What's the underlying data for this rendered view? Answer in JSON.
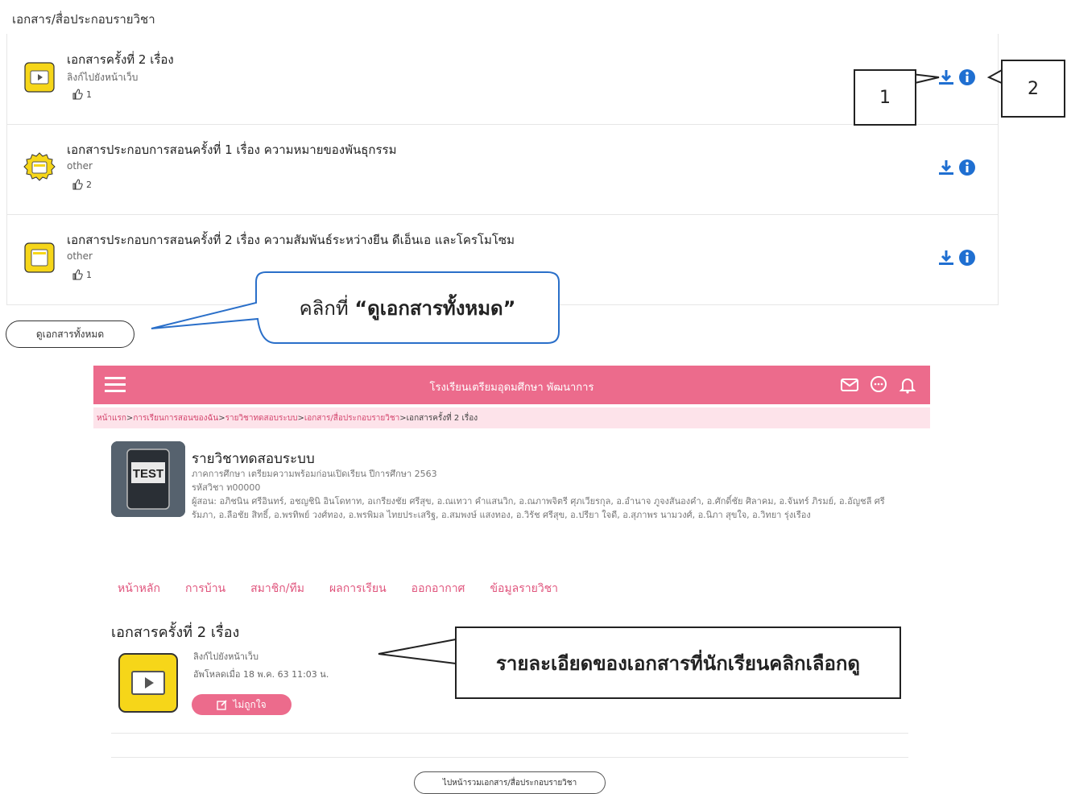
{
  "section_title": "เอกสาร/สื่อประกอบรายวิชา",
  "documents": [
    {
      "title": "เอกสารครั้งที่ 2 เรื่อง",
      "subtitle": "ลิงก์ไปยังหน้าเว็บ",
      "likes": "1",
      "icon": "video-doc-icon"
    },
    {
      "title": "เอกสารประกอบการสอนครั้งที่ 1 เรื่อง ความหมายของพันธุกรรม",
      "subtitle": "other",
      "likes": "2",
      "icon": "gear-doc-icon"
    },
    {
      "title": "เอกสารประกอบการสอนครั้งที่ 2 เรื่อง ความสัมพันธ์ระหว่างยีน ดีเอ็นเอ และโครโมโซม",
      "subtitle": "other",
      "likes": "1",
      "icon": "doc-icon"
    }
  ],
  "view_all_button": "ดูเอกสารทั้งหมด",
  "callouts": {
    "one": "1",
    "two": "2",
    "click_prefix": "คลิกที่ ",
    "click_target": "“ดูเอกสารทั้งหมด”",
    "detail": "รายละเอียดของเอกสารที่นักเรียนคลิกเลือกดู"
  },
  "embedded": {
    "header_title": "โรงเรียนเตรียมอุดมศึกษา พัฒนาการ",
    "breadcrumb": [
      "หน้าแรก",
      " > ",
      "การเรียนการสอนของฉัน",
      " > ",
      "รายวิชาทดสอบระบบ",
      " > ",
      "เอกสาร/สื่อประกอบรายวิชา",
      " > ",
      "เอกสารครั้งที่ 2 เรื่อง"
    ],
    "course": {
      "thumb_label": "TEST",
      "title": "รายวิชาทดสอบระบบ",
      "term": "ภาคการศึกษา เตรียมความพร้อมก่อนเปิดเรียน ปีการศึกษา 2563",
      "code": "รหัสวิชา ท00000",
      "instructors": "ผู้สอน: อภิชนิน ศรีอินทร์, อชญชินิ อินโดทาท, อเกรียงชัย ศรีสุข, อ.ณเทวา คำแสนวิก, อ.ณภาพจิตรี ศุภเวียรกุล, อ.อำนาจ ภูจงสันองคำ, อ.ศักดิ์ชัย ศิลาคม, อ.จันทร์ ภิรมย์, อ.อัญชลี ศรีรัมภา, อ.ลือชัย สิทธิ์, อ.พรทิพย์ วงศ์ทอง, อ.พรพิมล ไทยประเสริฐ, อ.สมพงษ์ แสงทอง, อ.วิรัช ศรีสุข, อ.ปรียา ใจดี, อ.สุภาพร นามวงศ์, อ.นิภา สุขใจ, อ.วิทยา รุ่งเรือง"
    },
    "tabs": [
      "หน้าหลัก",
      "การบ้าน",
      "สมาชิก/ทีม",
      "ผลการเรียน",
      "ออกอากาศ",
      "ข้อมูลรายวิชา"
    ],
    "doc_heading": "เอกสารครั้งที่ 2 เรื่อง",
    "doc_sub": "ลิงก์ไปยังหน้าเว็บ",
    "doc_date": "อัพโหลดเมื่อ 18 พ.ค. 63 11:03 น.",
    "like_button": "ไม่ถูกใจ",
    "back_button": "ไปหน้ารวมเอกสาร/สื่อประกอบรายวิชา"
  },
  "colors": {
    "pink": "#ec6b8c",
    "pink_light": "#fde3ea",
    "link_blue": "#1f6fd1",
    "yellow": "#f6d619"
  }
}
